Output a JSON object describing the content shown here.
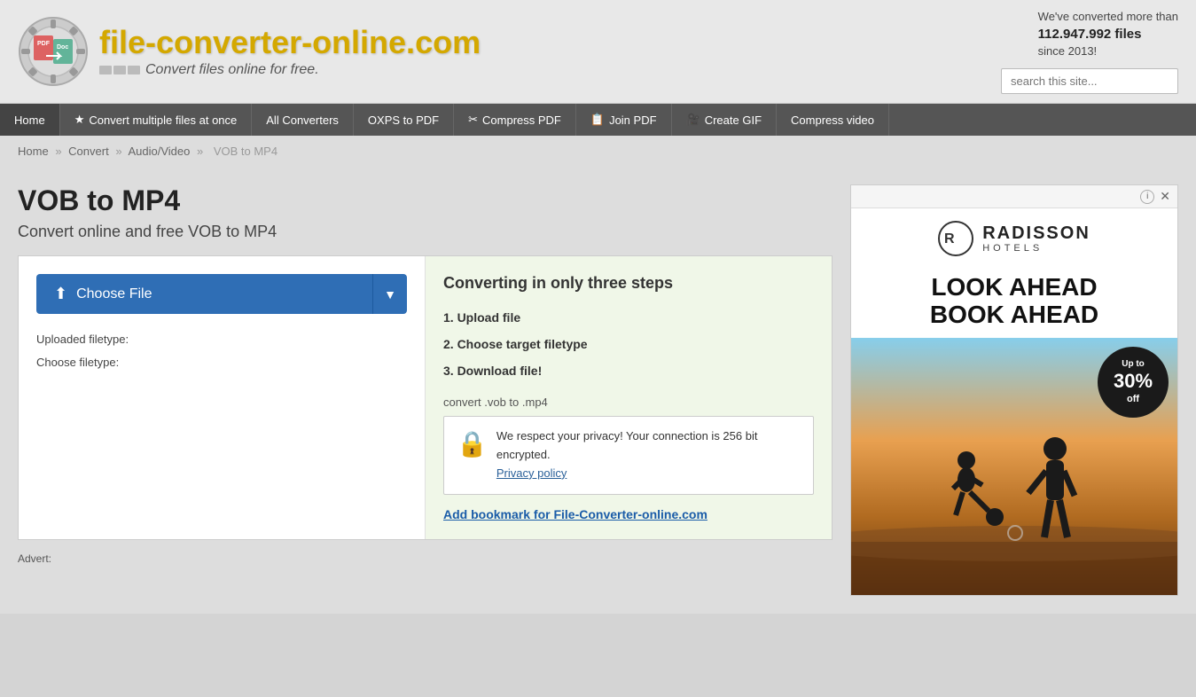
{
  "header": {
    "site_title": "file-converter-online.com",
    "site_subtitle": "Convert files online for free.",
    "conversion_count_line1": "We've converted more than",
    "conversion_count_number": "112.947.992 files",
    "conversion_count_line2": "since 2013!",
    "search_placeholder": "search this site..."
  },
  "nav": {
    "items": [
      {
        "label": "Home",
        "icon": ""
      },
      {
        "label": "Convert multiple files at once",
        "icon": "★"
      },
      {
        "label": "All Converters",
        "icon": ""
      },
      {
        "label": "OXPS to PDF",
        "icon": ""
      },
      {
        "label": "Compress PDF",
        "icon": "✂"
      },
      {
        "label": "Join PDF",
        "icon": "📋"
      },
      {
        "label": "Create GIF",
        "icon": "🎥"
      },
      {
        "label": "Compress video",
        "icon": ""
      }
    ]
  },
  "breadcrumb": {
    "items": [
      "Home",
      "Convert",
      "Audio/Video",
      "VOB to MP4"
    ],
    "separator": "»"
  },
  "main": {
    "page_title": "VOB to MP4",
    "page_subtitle": "Convert online and free VOB to MP4",
    "upload_panel": {
      "choose_file_label": "Choose File",
      "uploaded_filetype_label": "Uploaded filetype:",
      "choose_filetype_label": "Choose filetype:"
    },
    "steps_panel": {
      "title": "Converting in only three steps",
      "steps": [
        "1. Upload file",
        "2. Choose target filetype",
        "3. Download file!"
      ],
      "convert_label": "convert .vob to .mp4",
      "privacy_text": "We respect your privacy! Your connection is 256 bit encrypted.",
      "privacy_link": "Privacy policy",
      "bookmark_link": "Add bookmark for File-Converter-online.com"
    }
  },
  "ad": {
    "brand": "RADISSON",
    "brand_sub": "HOTELS",
    "headline_line1": "LOOK AHEAD",
    "headline_line2": "BOOK AHEAD",
    "discount_prefix": "Up to",
    "discount_percent": "30%",
    "discount_suffix": "off"
  },
  "advert_label": "Advert:"
}
